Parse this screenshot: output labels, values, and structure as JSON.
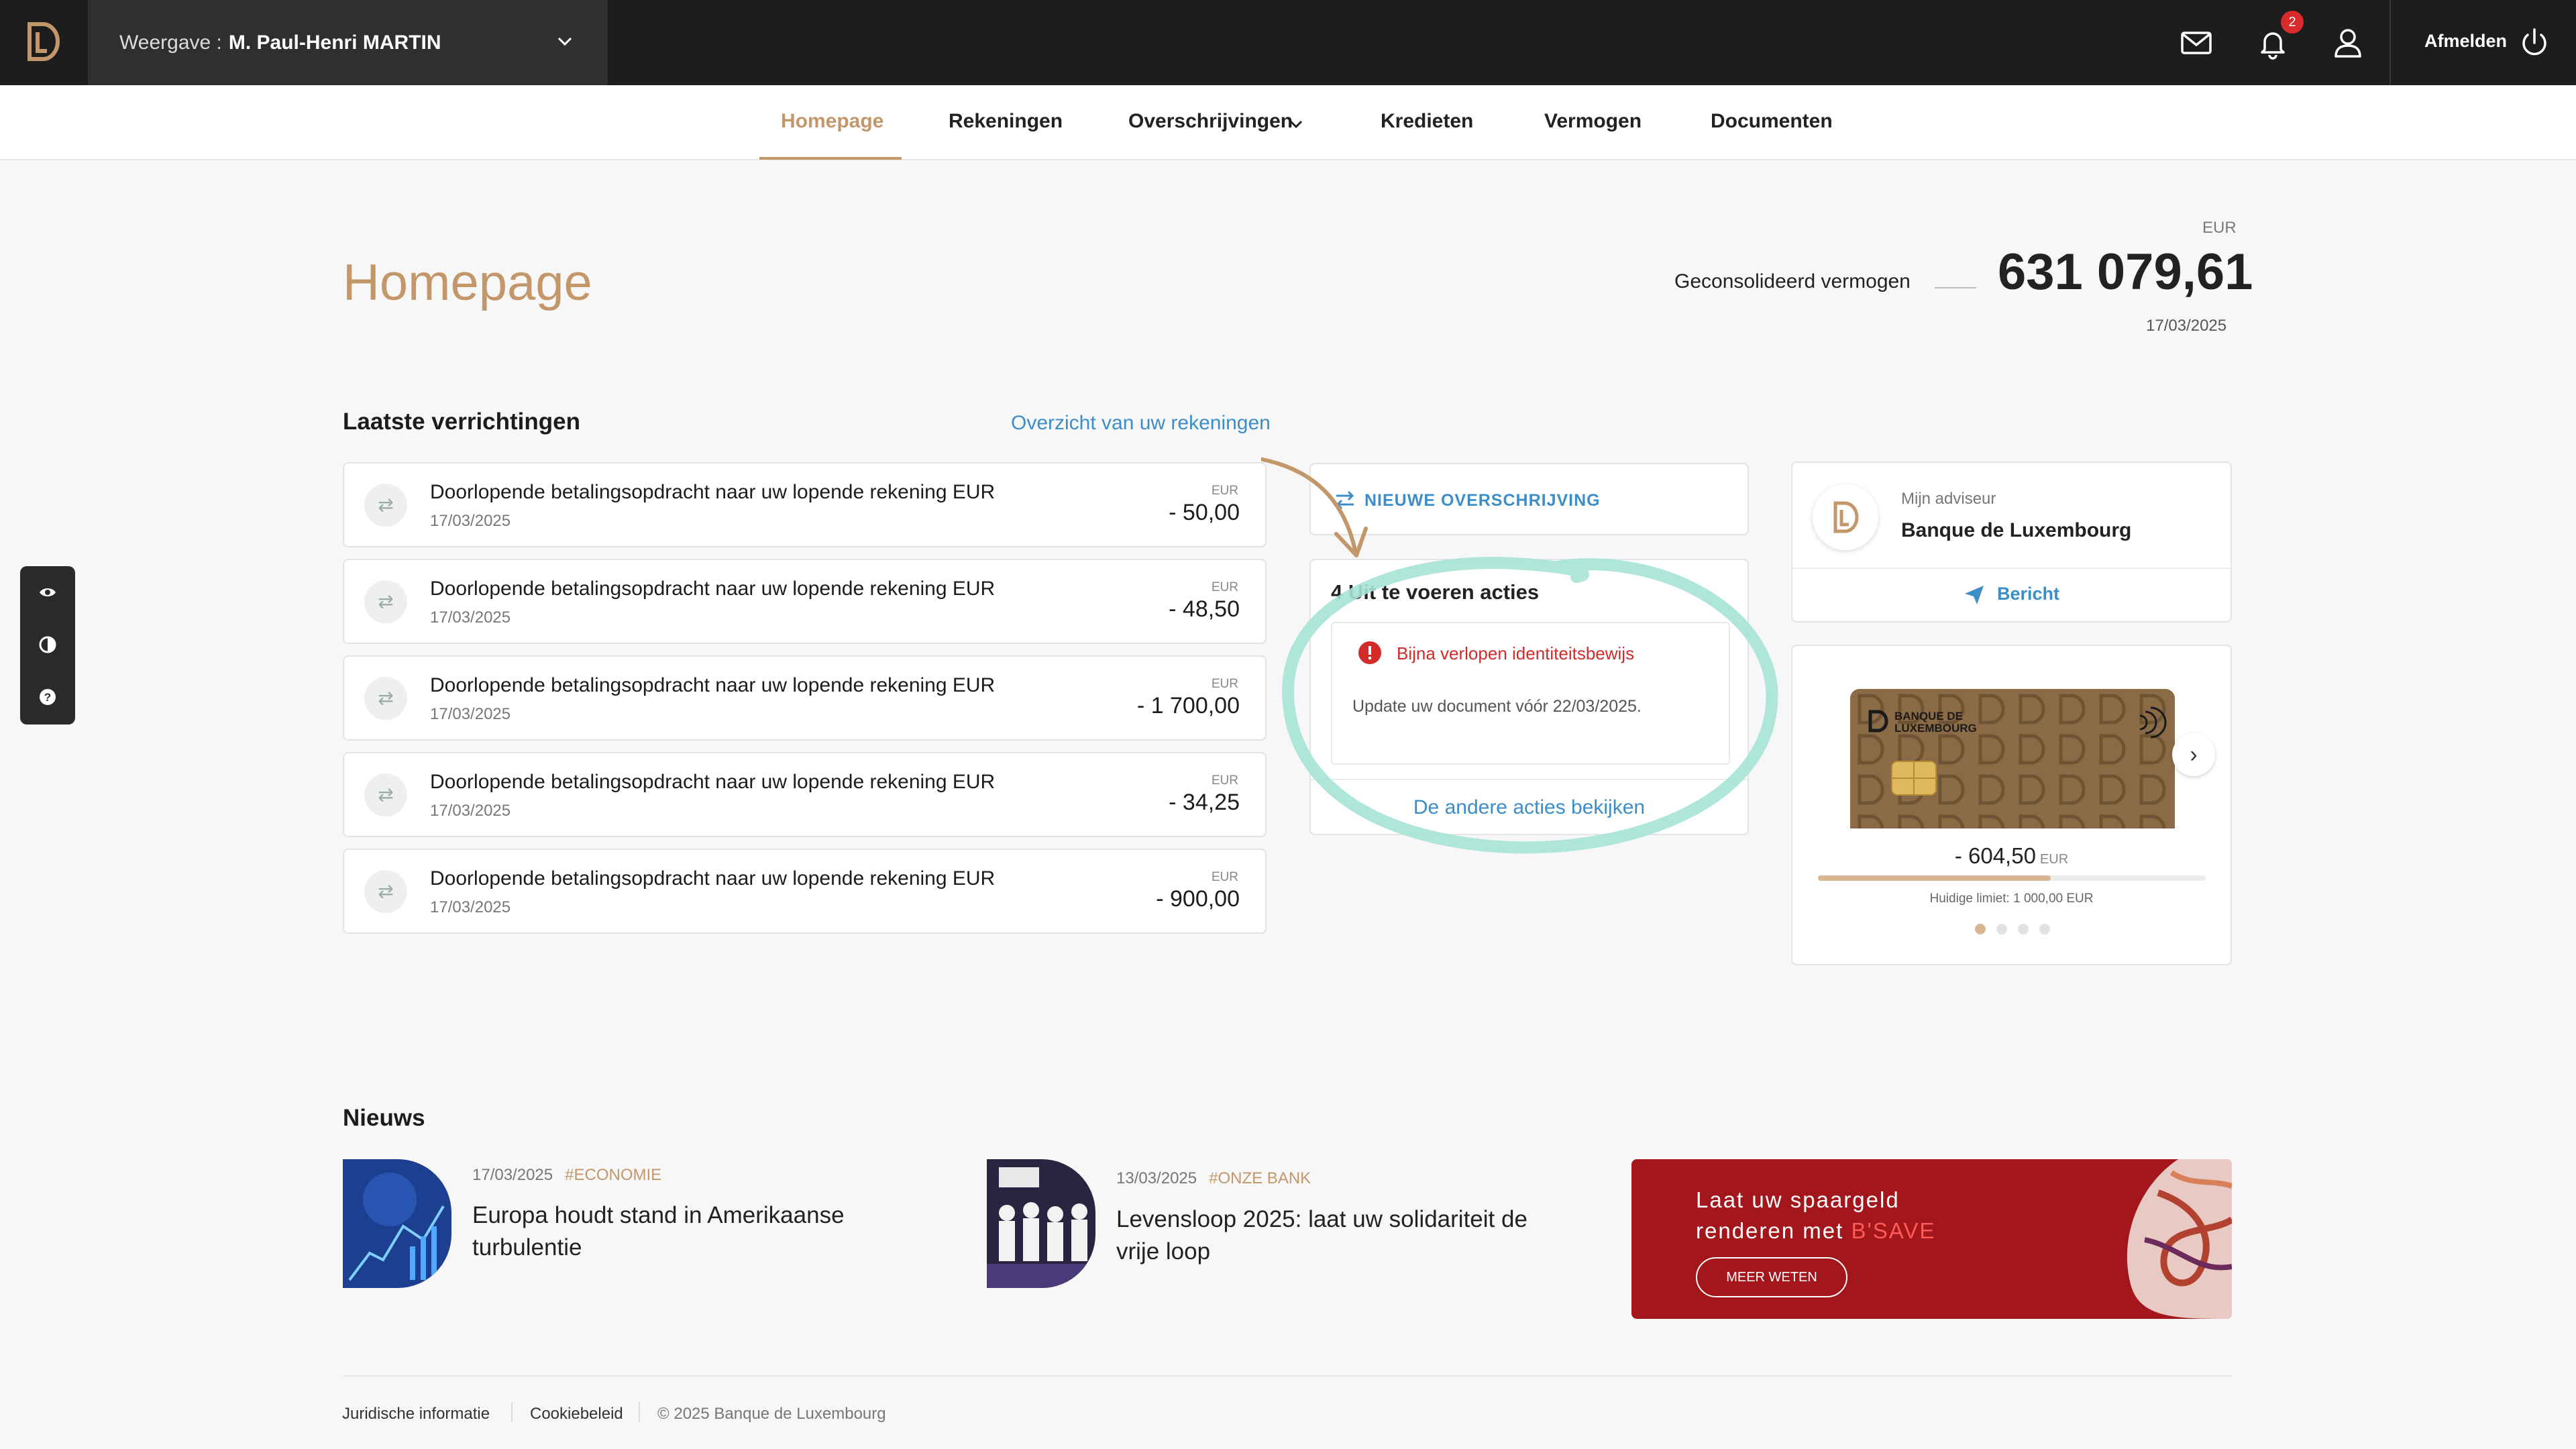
{
  "topbar": {
    "profile_label": "Weergave :",
    "profile_name": "M. Paul-Henri MARTIN",
    "notification_count": "2",
    "logout_label": "Afmelden"
  },
  "nav": {
    "items": [
      "Homepage",
      "Rekeningen",
      "Overschrijvingen",
      "Kredieten",
      "Vermogen",
      "Documenten"
    ],
    "active": "Homepage"
  },
  "page": {
    "title": "Homepage",
    "total_currency": "EUR",
    "total_label": "Geconsolideerd vermogen",
    "total_value": "631 079,61",
    "total_date": "17/03/2025"
  },
  "transactions": {
    "title": "Laatste verrichtingen",
    "overview_link": "Overzicht van uw rekeningen",
    "items": [
      {
        "description": "Doorlopende betalingsopdracht naar uw lopende rekening EUR",
        "date": "17/03/2025",
        "currency": "EUR",
        "amount": "- 50,00"
      },
      {
        "description": "Doorlopende betalingsopdracht naar uw lopende rekening EUR",
        "date": "17/03/2025",
        "currency": "EUR",
        "amount": "- 48,50"
      },
      {
        "description": "Doorlopende betalingsopdracht naar uw lopende rekening EUR",
        "date": "17/03/2025",
        "currency": "EUR",
        "amount": "- 1 700,00"
      },
      {
        "description": "Doorlopende betalingsopdracht naar uw lopende rekening EUR",
        "date": "17/03/2025",
        "currency": "EUR",
        "amount": "- 34,25"
      },
      {
        "description": "Doorlopende betalingsopdracht naar uw lopende rekening EUR",
        "date": "17/03/2025",
        "currency": "EUR",
        "amount": "- 900,00"
      }
    ]
  },
  "transfer": {
    "label": "NIEUWE OVERSCHRIJVING"
  },
  "actions": {
    "title": "4 Uit te voeren acties",
    "alert_title": "Bijna verlopen identiteitsbewijs",
    "alert_text": "Update uw document vóór 22/03/2025.",
    "more_link": "De andere acties bekijken"
  },
  "advisor": {
    "role": "Mijn adviseur",
    "name": "Banque de Luxembourg",
    "message_label": "Bericht"
  },
  "card": {
    "brand_text_1": "BANQUE DE",
    "brand_text_2": "LUXEMBOURG",
    "balance": "- 604,50",
    "currency": "EUR",
    "limit_text": "Huidige limiet: 1 000,00 EUR",
    "usage_fraction": 0.6,
    "slides": 4,
    "active_slide": 0
  },
  "news": {
    "title": "Nieuws",
    "items": [
      {
        "date": "17/03/2025",
        "tag": "#ECONOMIE",
        "headline_1": "Europa houdt stand in Amerikaanse",
        "headline_2": "turbulentie"
      },
      {
        "date": "13/03/2025",
        "tag": "#ONZE BANK",
        "headline_1": "Levensloop 2025: laat uw solidariteit de",
        "headline_2": "vrije loop"
      }
    ],
    "promo": {
      "line1": "Laat uw spaargeld",
      "line2_prefix": "renderen met ",
      "line2_highlight": "B'SAVE",
      "button": "MEER WETEN"
    }
  },
  "footer": {
    "legal": "Juridische informatie",
    "cookies": "Cookiebeleid",
    "copyright": "© 2025 Banque de Luxembourg"
  },
  "colors": {
    "accent": "#c3976a",
    "link": "#3c8ec9",
    "alert": "#d32a2a",
    "annotation": "#a6e3d6",
    "promo": "#a3161b"
  }
}
